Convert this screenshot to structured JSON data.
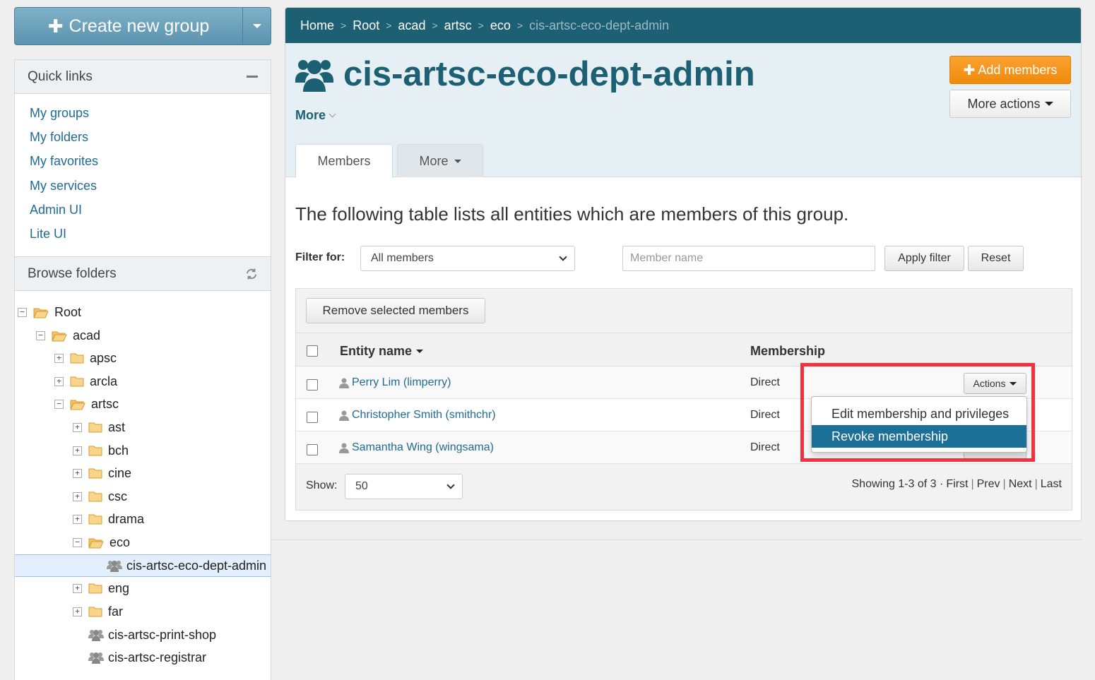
{
  "create_group": {
    "label": "Create new group"
  },
  "quick_links": {
    "title": "Quick links",
    "items": [
      "My groups",
      "My folders",
      "My favorites",
      "My services",
      "Admin UI",
      "Lite UI"
    ]
  },
  "browse_folders": {
    "title": "Browse folders",
    "tree": [
      {
        "label": "Root",
        "toggle": "−",
        "type": "folder-open"
      },
      {
        "label": "acad",
        "toggle": "−",
        "type": "folder-open"
      },
      {
        "label": "apsc",
        "toggle": "+",
        "type": "folder"
      },
      {
        "label": "arcla",
        "toggle": "+",
        "type": "folder"
      },
      {
        "label": "artsc",
        "toggle": "−",
        "type": "folder-open"
      },
      {
        "label": "ast",
        "toggle": "+",
        "type": "folder"
      },
      {
        "label": "bch",
        "toggle": "+",
        "type": "folder"
      },
      {
        "label": "cine",
        "toggle": "+",
        "type": "folder"
      },
      {
        "label": "csc",
        "toggle": "+",
        "type": "folder"
      },
      {
        "label": "drama",
        "toggle": "+",
        "type": "folder"
      },
      {
        "label": "eco",
        "toggle": "−",
        "type": "folder-open"
      },
      {
        "label": "cis-artsc-eco-dept-admin",
        "toggle": "",
        "type": "group"
      },
      {
        "label": "eng",
        "toggle": "+",
        "type": "folder"
      },
      {
        "label": "far",
        "toggle": "+",
        "type": "folder"
      },
      {
        "label": "cis-artsc-print-shop",
        "toggle": "",
        "type": "group"
      },
      {
        "label": "cis-artsc-registrar",
        "toggle": "",
        "type": "group"
      }
    ]
  },
  "breadcrumb": {
    "items": [
      "Home",
      "Root",
      "acad",
      "artsc",
      "eco"
    ],
    "current": "cis-artsc-eco-dept-admin"
  },
  "group": {
    "title": "cis-artsc-eco-dept-admin",
    "more_label": "More",
    "add_members_label": "Add members",
    "more_actions_label": "More actions"
  },
  "tabs": {
    "members": "Members",
    "more": "More"
  },
  "content": {
    "description": "The following table lists all entities which are members of this group.",
    "filter_label": "Filter for:",
    "filter_value": "All members",
    "name_placeholder": "Member name",
    "apply_filter": "Apply filter",
    "reset": "Reset",
    "remove_selected": "Remove selected members"
  },
  "table": {
    "columns": {
      "entity": "Entity name",
      "membership": "Membership"
    },
    "rows": [
      {
        "name": "Perry Lim (limperry)",
        "membership": "Direct"
      },
      {
        "name": "Christopher Smith (smithchr)",
        "membership": "Direct"
      },
      {
        "name": "Samantha Wing (wingsama)",
        "membership": "Direct"
      }
    ],
    "actions_label": "Actions",
    "dropdown": [
      "Edit membership and privileges",
      "Revoke membership"
    ],
    "show_label": "Show:",
    "show_value": "50",
    "pager": {
      "summary": "Showing 1-3 of 3 ·",
      "first": "First",
      "prev": "Prev",
      "next": "Next",
      "last": "Last"
    }
  },
  "colors": {
    "brand": "#1d5f73",
    "accent": "#f08a0c",
    "link": "#1f6b96",
    "highlight": "#f0333f"
  }
}
